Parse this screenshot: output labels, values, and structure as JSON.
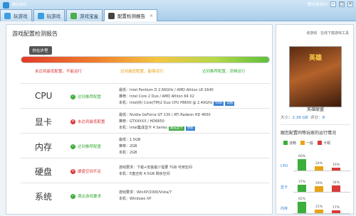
{
  "window": {
    "app": "腾讯游戏",
    "user": "腾讯游戏ID"
  },
  "tabs": [
    {
      "label": "玩游戏",
      "color": "#3aa0e0"
    },
    {
      "label": "玩游戏",
      "color": "#3aa0e0"
    },
    {
      "label": "游戏宝盒",
      "color": "#4cae4c"
    },
    {
      "label": "配置检测报告",
      "color": "#444444"
    }
  ],
  "report": {
    "title": "游戏配置检测报告",
    "overall_badge": "你在这里",
    "overall_level": 0.09,
    "levels": [
      {
        "label": "未达到最低配置，不能运行",
        "color": "#d93a3a"
      },
      {
        "label": "达到最低配置，能够运行",
        "color": "#e6a317"
      },
      {
        "label": "达到推荐配置，流畅运行",
        "color": "#3bae3b"
      }
    ],
    "specs": [
      {
        "name": "CPU",
        "status": "达到推荐配置",
        "ok": true,
        "lines": [
          "最低：Intel Pentium D 2.66GHz / AMD Athlon LE-1640",
          "推荐：Intel Core 2 Duo / AMD Athlon 64 X2",
          "本机：Intel(R) Core(TM)2 Duo CPU P8600 @ 2.40GHz"
        ],
        "tags": [
          "Intel",
          "双核"
        ]
      },
      {
        "name": "显卡",
        "status": "未达到最低配置",
        "ok": false,
        "lines": [
          "最低：Nvidia GeForce GT 130 / ATI Radeon HD 4650",
          "推荐：GTX4XXX / HD6850",
          "本机：Intel集成显卡 4 Series"
        ],
        "tags": [
          "集成显卡",
          "更新"
        ]
      },
      {
        "name": "内存",
        "status": "达到推荐配置",
        "ok": true,
        "lines": [
          "最低：1.5GB",
          "推荐：2GB",
          "本机：2GB"
        ],
        "tags": []
      },
      {
        "name": "硬盘",
        "status": "硬盘空间不足",
        "ok": false,
        "lines": [
          "游戏要求：下载+安装最少需要 7GB 可用空间",
          "本机：E盘还有 4.5GB 剩余空间"
        ],
        "tags": []
      },
      {
        "name": "系统",
        "status": "满足游戏要求",
        "ok": true,
        "lines": [
          "游戏要求：WinXP/2000/Vista/7",
          "本机：Windows XP"
        ],
        "tags": []
      }
    ]
  },
  "side": {
    "link": "该游戏 · 在线下载游戏工具",
    "cover_text": "英雄",
    "game_name": "英雄联盟",
    "size_label": "大小：",
    "size": "2.39 GB",
    "players_label": "评分：",
    "players": "8",
    "dist_title": "跟您配置同等玩家的运行情况",
    "legend": [
      {
        "label": "流畅",
        "color": "#3bae3b"
      },
      {
        "label": "一般",
        "color": "#e6a317"
      },
      {
        "label": "卡顿",
        "color": "#d93a3a"
      }
    ],
    "dist": [
      {
        "label": "CPU",
        "values": [
          60,
          24,
          16
        ]
      },
      {
        "label": "显卡",
        "values": [
          37,
          29,
          34
        ]
      },
      {
        "label": "内存",
        "values": [
          62,
          21,
          17
        ]
      }
    ]
  }
}
